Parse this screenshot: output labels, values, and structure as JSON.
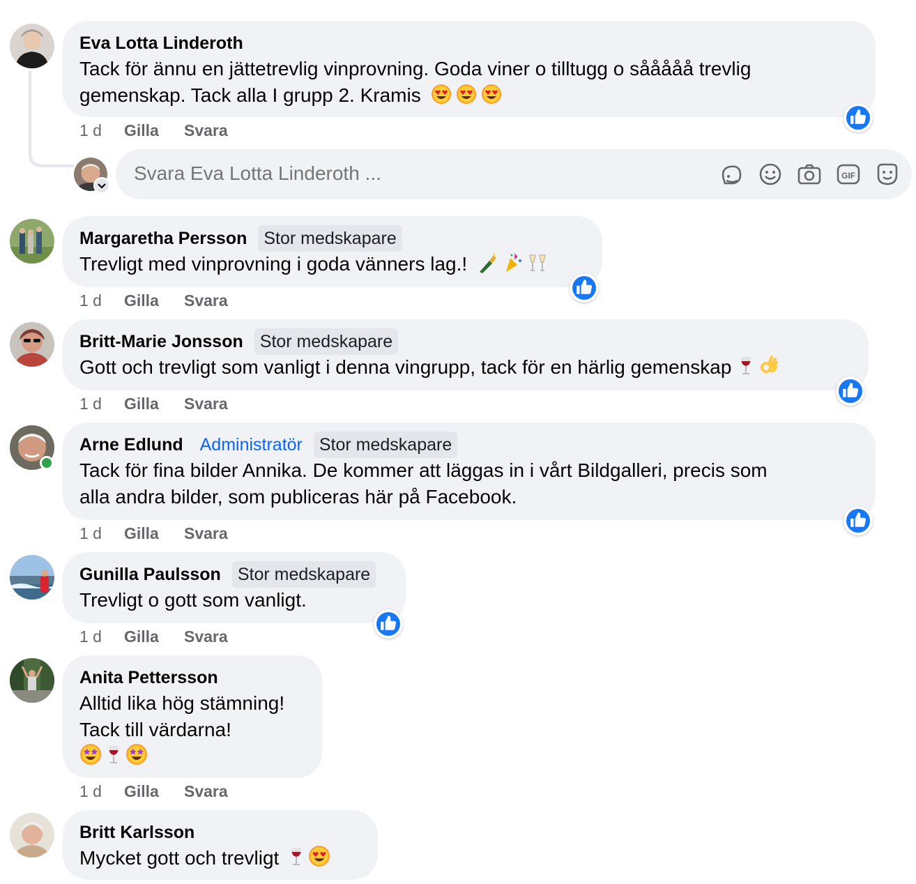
{
  "comments": [
    {
      "author": "Eva Lotta Linderoth",
      "badges": [],
      "lines": [
        "Tack för ännu en jättetrevlig vinprovning. Goda viner o tilltugg o sååååå trevlig",
        "gemenskap. Tack alla I grupp 2. Kramis"
      ],
      "emojis": [
        "heart-eyes",
        "heart-eyes",
        "heart-eyes"
      ],
      "time": "1 d",
      "like": "Gilla",
      "reply": "Svara"
    },
    {
      "author": "Margaretha Persson",
      "badges": [
        "Stor medskapare"
      ],
      "lines": [
        "Trevligt med vinprovning i goda vänners lag.!"
      ],
      "emojis": [
        "champagne-bottle",
        "party-popper",
        "champagne-glasses"
      ],
      "time": "1 d",
      "like": "Gilla",
      "reply": "Svara"
    },
    {
      "author": "Britt-Marie Jonsson",
      "badges": [
        "Stor medskapare"
      ],
      "lines": [
        "Gott och trevligt som vanligt i denna vingrupp, tack för en härlig gemenskap"
      ],
      "emojis": [
        "wine-glass",
        "ok-hand"
      ],
      "time": "1 d",
      "like": "Gilla",
      "reply": "Svara"
    },
    {
      "author": "Arne Edlund",
      "badges": [
        "Administratör",
        "Stor medskapare"
      ],
      "lines": [
        "Tack för fina bilder Annika. De kommer att läggas in i vårt Bildgalleri, precis som",
        "alla andra bilder, som publiceras här på Facebook."
      ],
      "emojis": [],
      "time": "1 d",
      "like": "Gilla",
      "reply": "Svara"
    },
    {
      "author": "Gunilla Paulsson",
      "badges": [
        "Stor medskapare"
      ],
      "lines": [
        "Trevligt o gott som vanligt."
      ],
      "emojis": [],
      "time": "1 d",
      "like": "Gilla",
      "reply": "Svara"
    },
    {
      "author": "Anita Pettersson",
      "badges": [],
      "lines": [
        "Alltid lika hög stämning!",
        "Tack till värdarna!"
      ],
      "emojis": [
        "star-struck",
        "wine-glass",
        "star-struck"
      ],
      "time": "1 d",
      "like": "Gilla",
      "reply": "Svara"
    },
    {
      "author": "Britt Karlsson",
      "badges": [],
      "lines": [
        "Mycket gott och trevligt"
      ],
      "emojis": [
        "wine-glass",
        "heart-eyes"
      ]
    }
  ],
  "reply_box": {
    "placeholder": "Svara Eva Lotta Linderoth ...",
    "tools": [
      "avatar-sticker-icon",
      "emoji-icon",
      "camera-icon",
      "gif-icon",
      "sticker-icon"
    ],
    "gif_label": "GIF"
  },
  "colors": {
    "bubble": "#f0f2f5",
    "badge": "#e4e6eb",
    "admin": "#0866ff",
    "like_blue": "#1877f2",
    "meta": "#65676b",
    "online": "#31a24c"
  }
}
